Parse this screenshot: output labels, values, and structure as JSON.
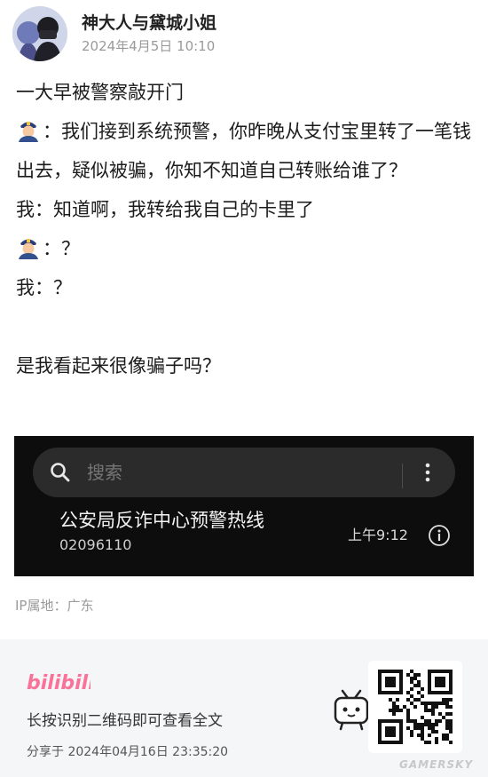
{
  "author": {
    "name": "神大人与黛城小姐",
    "date": "2024年4月5日 10:10"
  },
  "post": {
    "line1": "一大早被警察敲开门",
    "police_line1": "：我们接到系统预警，你昨晚从支付宝里转了一笔钱出去，疑似被骗，你知不知道自己转账给谁了？",
    "me_line1": "我：知道啊，我转给我自己的卡里了",
    "police_line2": "：？",
    "me_line2": "我：？",
    "closing": "是我看起来很像骗子吗？",
    "police_icon": "police-officer-emoji"
  },
  "screenshot": {
    "search_placeholder": "搜索",
    "call_name": "公安局反诈中心预警热线",
    "call_number": "02096110",
    "call_time": "上午9:12"
  },
  "ip_location": "IP属地：广东",
  "footer": {
    "brand": "bilibili",
    "scan_text": "长按识别二维码即可查看全文",
    "share_date": "分享于 2024年04月16日 23:35:20",
    "brand_color": "#fb7299"
  },
  "watermark": "GAMERSKY"
}
